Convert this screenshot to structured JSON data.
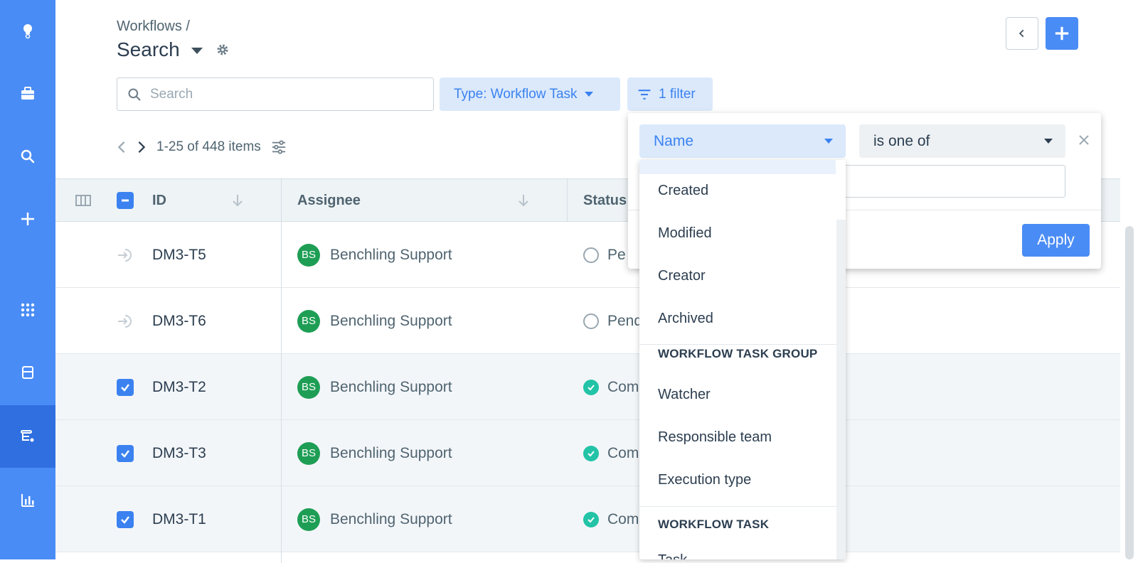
{
  "header": {
    "breadcrumb": "Workflows /",
    "title": "Search"
  },
  "toolbar": {
    "search_placeholder": "Search",
    "type_chip": "Type: Workflow Task",
    "filter_chip": "1 filter"
  },
  "pagination": {
    "range_text": "1-25 of 448 items"
  },
  "table": {
    "columns": [
      "ID",
      "Assignee",
      "Status"
    ],
    "rows": [
      {
        "id": "DM3-T5",
        "avatar": "BS",
        "assignee": "Benchling Support",
        "status": "Pe",
        "status_type": "pending",
        "selected": false
      },
      {
        "id": "DM3-T6",
        "avatar": "BS",
        "assignee": "Benchling Support",
        "status": "Pend",
        "status_type": "pending",
        "selected": false
      },
      {
        "id": "DM3-T2",
        "avatar": "BS",
        "assignee": "Benchling Support",
        "status": "Com",
        "status_type": "completed",
        "selected": true
      },
      {
        "id": "DM3-T3",
        "avatar": "BS",
        "assignee": "Benchling Support",
        "status": "Com",
        "status_type": "completed",
        "selected": true
      },
      {
        "id": "DM3-T1",
        "avatar": "BS",
        "assignee": "Benchling Support",
        "status": "Com",
        "status_type": "completed",
        "selected": true
      }
    ]
  },
  "filter_panel": {
    "field": "Name",
    "operator": "is one of",
    "apply_label": "Apply"
  },
  "dropdown": {
    "items_group1": [
      "Created",
      "Modified",
      "Creator",
      "Archived"
    ],
    "group2_header": "WORKFLOW TASK GROUP",
    "items_group2": [
      "Watcher",
      "Responsible team",
      "Execution type"
    ],
    "group3_header": "WORKFLOW TASK",
    "items_group3_partial": "Task"
  },
  "colors": {
    "sidebar": "#4a8cf5",
    "sidebar_active": "#2f6fe0",
    "accent": "#3b82f0",
    "avatar": "#1e9e55",
    "completed": "#22c3a6"
  }
}
